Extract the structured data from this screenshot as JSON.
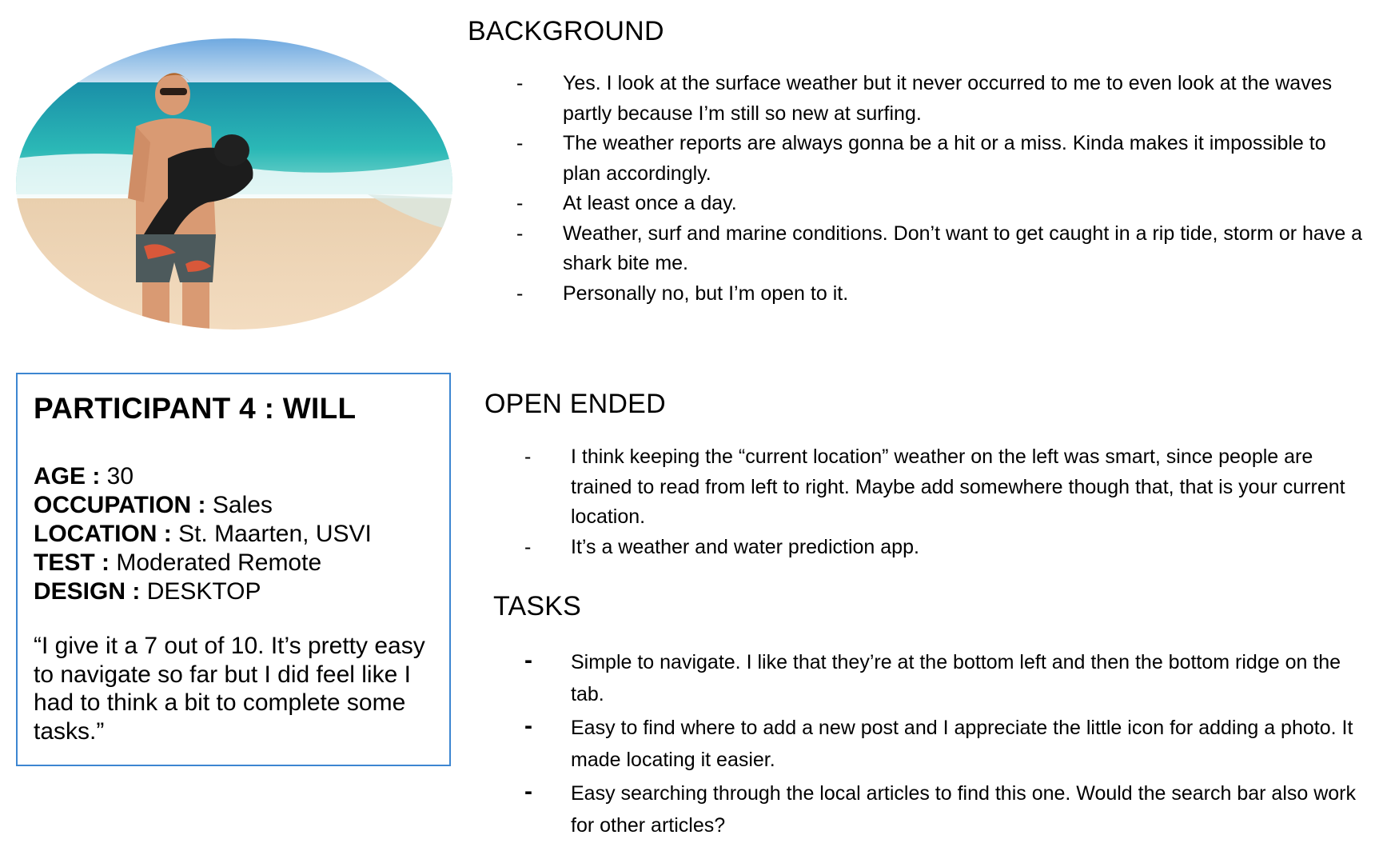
{
  "participant": {
    "title": "PARTICIPANT 4 : WILL",
    "facts": [
      {
        "label": "AGE :",
        "value": " 30"
      },
      {
        "label": "OCCUPATION :",
        "value": " Sales"
      },
      {
        "label": "LOCATION :",
        "value": " St. Maarten, USVI"
      },
      {
        "label": "TEST :",
        "value": " Moderated Remote"
      },
      {
        "label": "DESIGN :",
        "value": " DESKTOP"
      }
    ],
    "quote": "“I give it a 7 out of 10. It’s pretty easy to navigate so far but I did feel like I had to think a bit to complete some tasks.”",
    "photo_icon": "participant-photo"
  },
  "background": {
    "heading": "BACKGROUND",
    "items": [
      "Yes. I look at the surface weather but it never occurred to me to even look at the waves partly because I’m still so new at surfing.",
      "The weather reports are always gonna be a hit or a miss. Kinda makes it impossible to plan accordingly.",
      "At least once a day.",
      "Weather, surf and marine conditions. Don’t want to get caught in a rip tide, storm or have a shark bite me.",
      "Personally no, but I’m open to it."
    ]
  },
  "open_ended": {
    "heading": "OPEN ENDED",
    "items": [
      "I think keeping the “current location” weather on the left was smart, since people are trained to read from left to right. Maybe add somewhere though that, that is your current location.",
      "It’s a weather and water prediction app."
    ]
  },
  "tasks": {
    "heading": "TASKS",
    "items": [
      "Simple to navigate. I like that they’re at the bottom left and then the bottom ridge on the tab.",
      "Easy to find where to add a new post and I appreciate the little icon for adding a photo. It made locating it easier.",
      "Easy searching through the local articles to find this one. Would the search bar also work for other articles?"
    ]
  },
  "dash": "-",
  "colors": {
    "card_border": "#3d86d1"
  }
}
